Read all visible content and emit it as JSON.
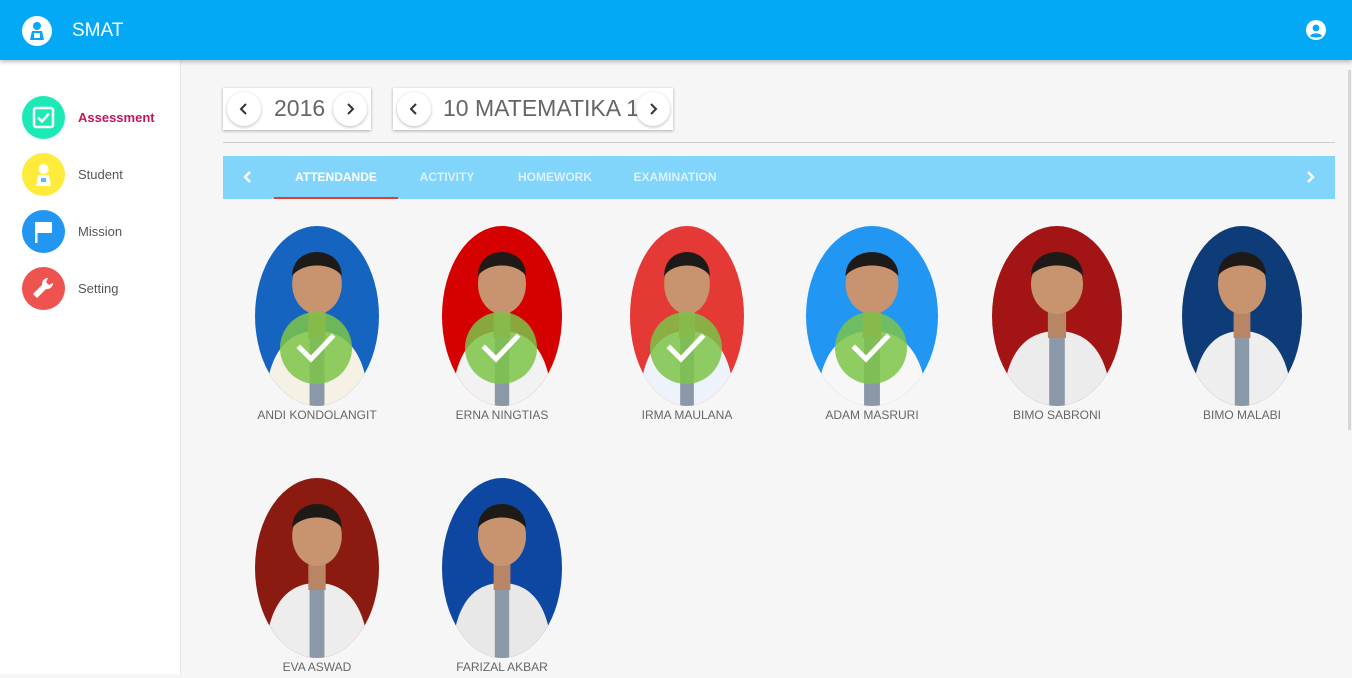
{
  "app": {
    "title": "SMAT"
  },
  "sidebar": {
    "items": [
      {
        "label": "Assessment",
        "icon": "checkbox-icon",
        "color": "#1de9b6",
        "active": true
      },
      {
        "label": "Student",
        "icon": "student-icon",
        "color": "#ffeb3b",
        "active": false
      },
      {
        "label": "Mission",
        "icon": "flag-icon",
        "color": "#2196f3",
        "active": false
      },
      {
        "label": "Setting",
        "icon": "wrench-icon",
        "color": "#ef5350",
        "active": false
      }
    ]
  },
  "selectors": {
    "year": "2016",
    "class": "10 MATEMATIKA 1"
  },
  "tabs": [
    {
      "label": "ATTENDANDE",
      "active": true
    },
    {
      "label": "ACTIVITY",
      "active": false
    },
    {
      "label": "HOMEWORK",
      "active": false
    },
    {
      "label": "EXAMINATION",
      "active": false
    }
  ],
  "students": [
    {
      "name": "ANDI KONDOLANGIT",
      "background": "#1565c0",
      "shirt": "#f5f1e4",
      "present": true
    },
    {
      "name": "ERNA NINGTIAS",
      "background": "#d50000",
      "shirt": "#f2f2f2",
      "present": true
    },
    {
      "name": "IRMA MAULANA",
      "background": "#e53935",
      "shirt": "#eef3fb",
      "present": true
    },
    {
      "name": "ADAM MASRURI",
      "background": "#2196f3",
      "shirt": "#f7f7f7",
      "present": true
    },
    {
      "name": "BIMO SABRONI",
      "background": "#a31515",
      "shirt": "#ececec",
      "present": false
    },
    {
      "name": "BIMO MALABI",
      "background": "#0d3c78",
      "shirt": "#eeeeee",
      "present": false
    },
    {
      "name": "EVA ASWAD",
      "background": "#8b1a10",
      "shirt": "#ededed",
      "present": false
    },
    {
      "name": "FARIZAL AKBAR",
      "background": "#0d47a1",
      "shirt": "#e8e8e8",
      "present": false
    }
  ],
  "colors": {
    "primary": "#03a9f4",
    "tabbar": "#81d4fa",
    "tab_indicator": "#e53935",
    "present_check": "#7cc448",
    "active_nav_text": "#c2185b"
  }
}
